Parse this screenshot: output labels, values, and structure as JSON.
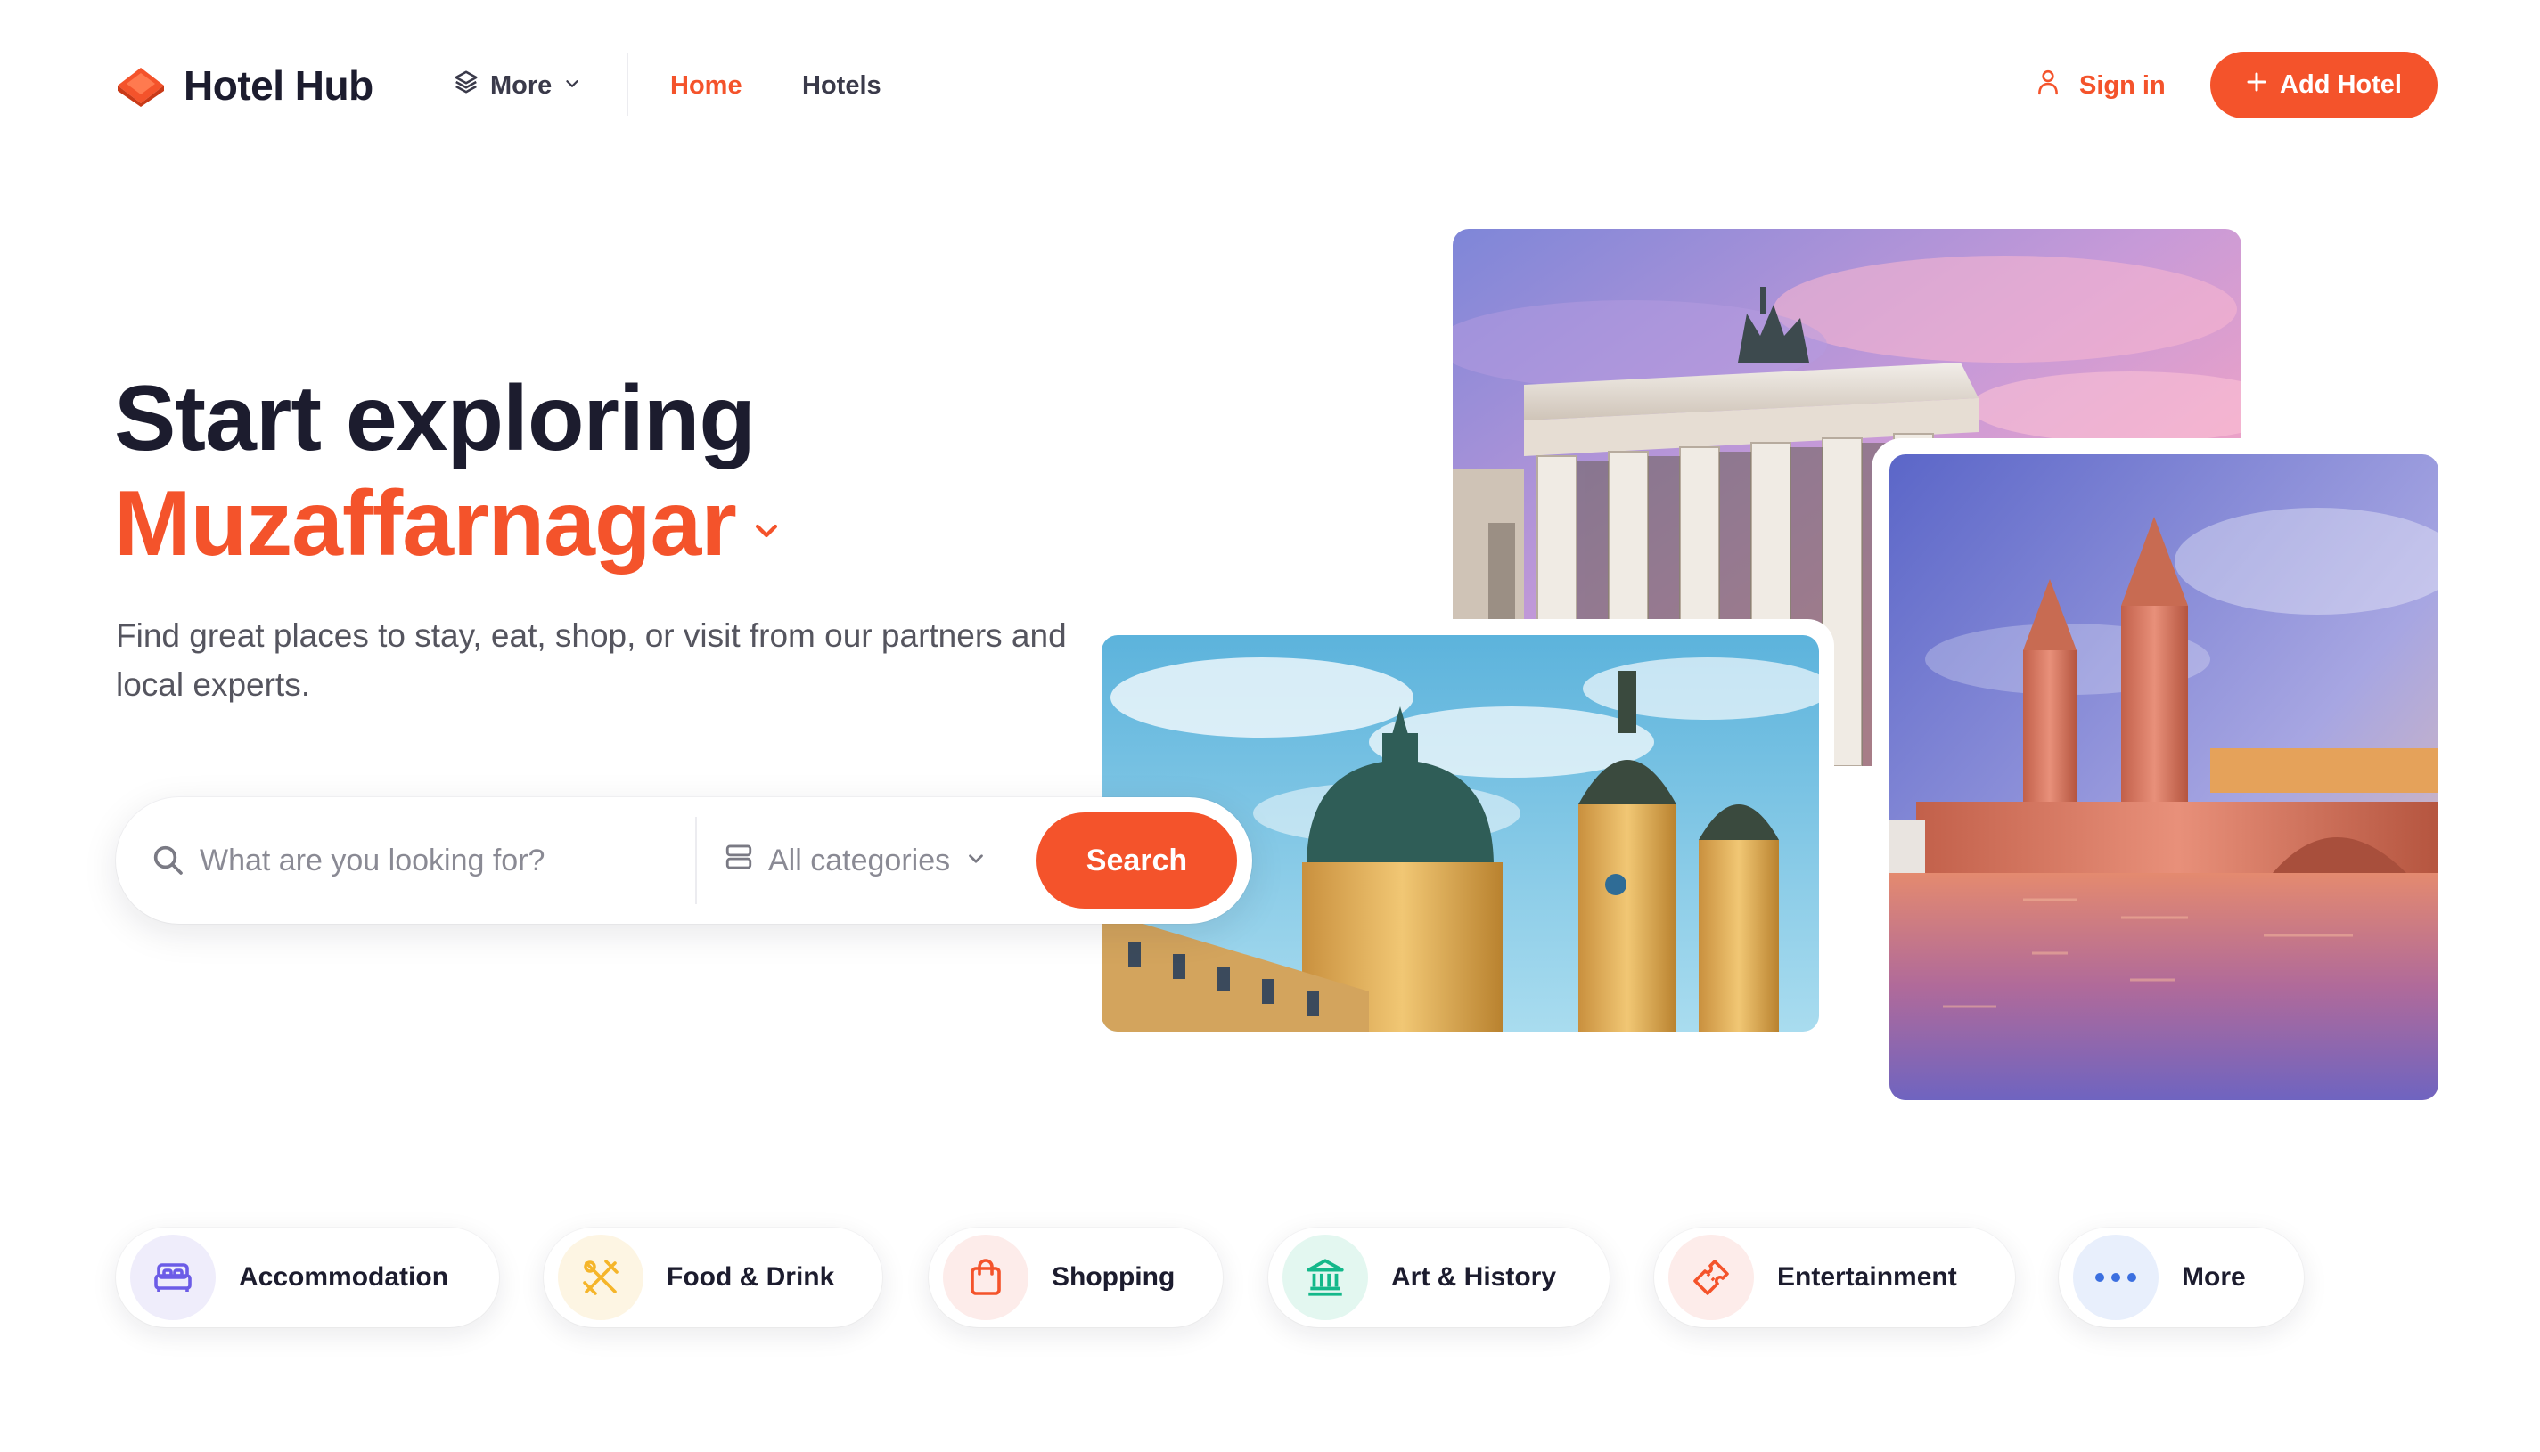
{
  "brand": {
    "name": "Hotel Hub",
    "accent_color": "#f4532b"
  },
  "nav": {
    "more_label": "More",
    "links": [
      {
        "label": "Home",
        "active": true
      },
      {
        "label": "Hotels",
        "active": false
      }
    ],
    "signin_label": "Sign in",
    "add_hotel_label": "Add Hotel"
  },
  "hero": {
    "title": "Start exploring",
    "city": "Muzaffarnagar",
    "subtitle": "Find great places to stay, eat, shop, or visit from our partners and local experts."
  },
  "search": {
    "placeholder": "What are you looking for?",
    "category_label": "All categories",
    "button_label": "Search"
  },
  "images": [
    {
      "icon": "brandenburg-gate-photo"
    },
    {
      "icon": "theatine-church-photo"
    },
    {
      "icon": "oberbaum-bridge-photo"
    }
  ],
  "categories": [
    {
      "label": "Accommodation",
      "icon": "bed-icon",
      "color": "#6c5ce7",
      "bg": "#efedfb"
    },
    {
      "label": "Food & Drink",
      "icon": "utensils-icon",
      "color": "#f5b52a",
      "bg": "#fdf5e3"
    },
    {
      "label": "Shopping",
      "icon": "shopping-bag-icon",
      "color": "#f4532b",
      "bg": "#fdecea"
    },
    {
      "label": "Art & History",
      "icon": "museum-icon",
      "color": "#14b88a",
      "bg": "#e3f7f0"
    },
    {
      "label": "Entertainment",
      "icon": "ticket-icon",
      "color": "#f4532b",
      "bg": "#fdecea"
    },
    {
      "label": "More",
      "icon": "more-dots-icon",
      "color": "#3b6fe0",
      "bg": "#e8effc"
    }
  ]
}
